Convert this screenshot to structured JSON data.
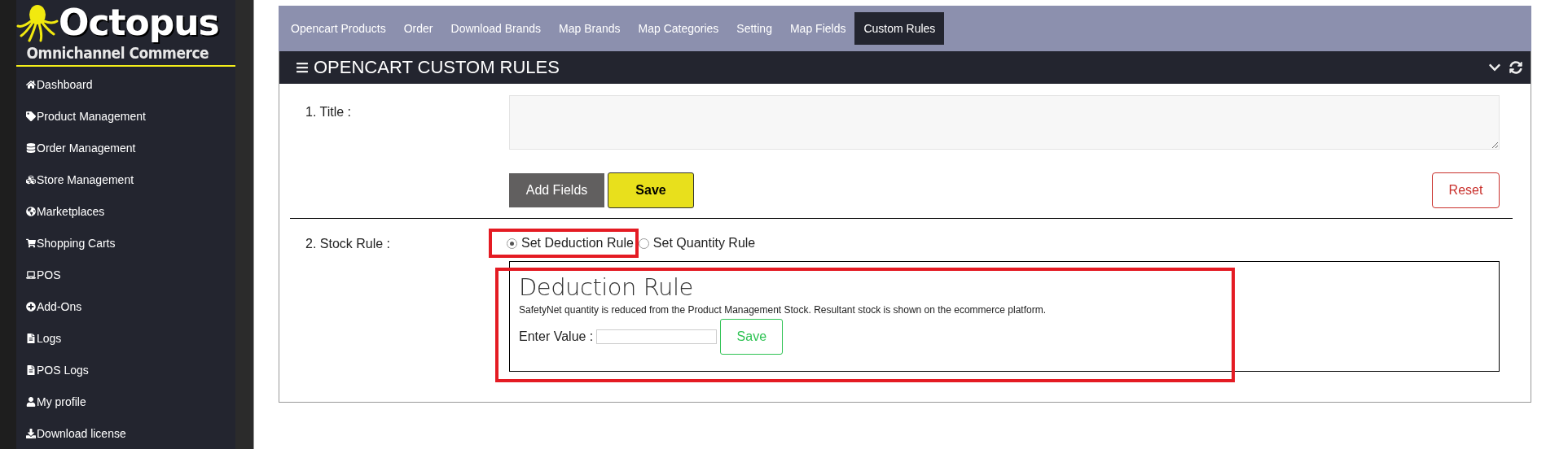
{
  "sidebar": {
    "logo": {
      "title": "Octopus",
      "subtitle": "Omnichannel Commerce"
    },
    "items": [
      {
        "label": "Dashboard"
      },
      {
        "label": "Product Management"
      },
      {
        "label": "Order Management"
      },
      {
        "label": "Store Management"
      },
      {
        "label": "Marketplaces"
      },
      {
        "label": "Shopping Carts"
      },
      {
        "label": "POS"
      },
      {
        "label": "Add-Ons"
      },
      {
        "label": "Logs"
      },
      {
        "label": "POS Logs"
      },
      {
        "label": "My profile"
      },
      {
        "label": "Download license"
      }
    ]
  },
  "tabs": [
    {
      "label": "Opencart Products",
      "selected": false
    },
    {
      "label": "Order",
      "selected": false
    },
    {
      "label": "Download Brands",
      "selected": false
    },
    {
      "label": "Map Brands",
      "selected": false
    },
    {
      "label": "Map Categories",
      "selected": false
    },
    {
      "label": "Setting",
      "selected": false
    },
    {
      "label": "Map Fields",
      "selected": false
    },
    {
      "label": "Custom Rules",
      "selected": true
    }
  ],
  "panel": {
    "title": "OPENCART CUSTOM RULES",
    "title_row": {
      "label": "1. Title :",
      "buttons": [
        {
          "label": "Add Fields",
          "kind": "secondary"
        },
        {
          "label": "Save",
          "kind": "primary"
        },
        {
          "label": "Reset",
          "kind": "danger"
        }
      ]
    },
    "stock_row": {
      "label": "2. Stock Rule :",
      "options": [
        {
          "label": "Set Deduction Rule",
          "selected": true,
          "highlighted": true
        },
        {
          "label": "Set Quantity Rule",
          "selected": false,
          "highlighted": false
        }
      ],
      "rule_box": {
        "title": "Deduction Rule",
        "description": "SafetyNet quantity is reduced from the Product Management Stock. Resultant stock is shown on the ecommerce platform.",
        "value_label": "Enter Value :",
        "save": "Save",
        "highlighted": true
      }
    }
  }
}
